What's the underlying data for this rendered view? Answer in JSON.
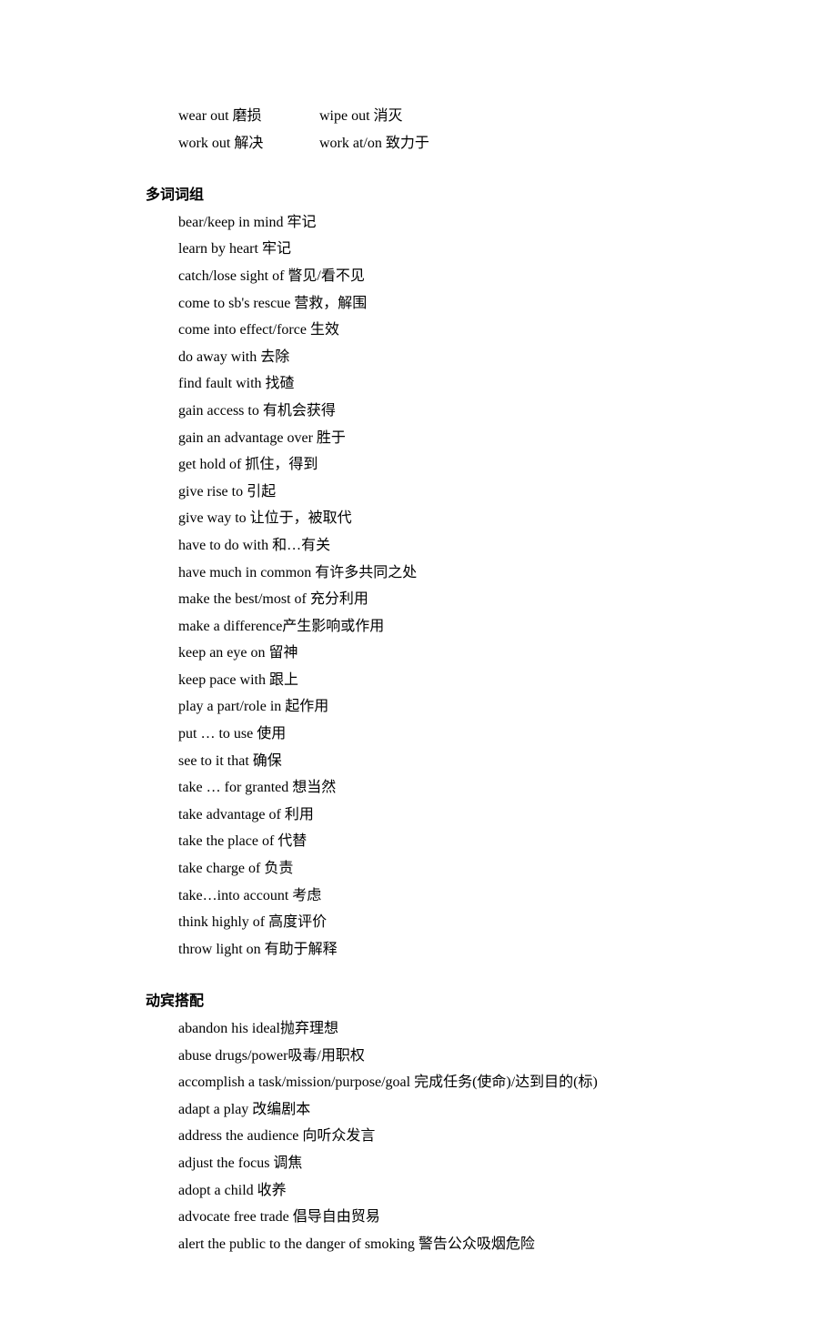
{
  "topRows": [
    {
      "col1": "wear out  磨损",
      "col2": "wipe out  消灭"
    },
    {
      "col1": "work out  解决",
      "col2": "work at/on  致力于"
    }
  ],
  "sections": [
    {
      "title": "多词词组",
      "entries": [
        "bear/keep in mind  牢记",
        "learn by heart  牢记",
        "catch/lose sight of  瞥见/看不见",
        "come to sb's rescue  营救，解围",
        "come into effect/force  生效",
        "do away with 去除",
        "find fault with  找碴",
        "gain access to  有机会获得",
        "gain an advantage over  胜于",
        "get hold of  抓住，得到",
        "give rise to 引起",
        "give way to  让位于，被取代",
        "have to do with  和…有关",
        "have much in common  有许多共同之处",
        "make the best/most of 充分利用",
        "make a difference产生影响或作用",
        "keep an eye on 留神",
        "keep pace with 跟上",
        "play a part/role in 起作用",
        "put  …  to use  使用",
        "see to it that 确保",
        "take  …  for granted  想当然",
        "take advantage of  利用",
        "take the place of  代替",
        "take charge of  负责",
        "take…into account 考虑",
        "think highly of  高度评价",
        "throw light on 有助于解释"
      ]
    },
    {
      "title": "动宾搭配",
      "entries": [
        "abandon his ideal抛弃理想",
        "abuse drugs/power吸毒/用职权",
        "accomplish a task/mission/purpose/goal 完成任务(使命)/达到目的(标)",
        "adapt a play  改编剧本",
        "address the audience  向听众发言",
        "adjust the focus  调焦",
        "adopt a child  收养",
        "advocate free trade  倡导自由贸易",
        "alert the public to the danger of smoking  警告公众吸烟危险"
      ]
    }
  ]
}
